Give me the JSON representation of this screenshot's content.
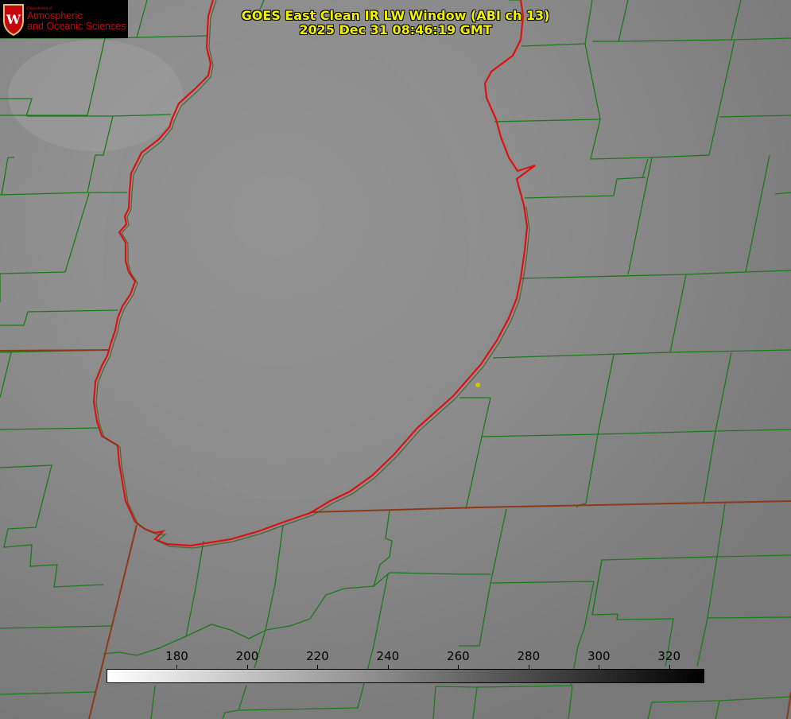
{
  "title": {
    "line1": "GOES East Clean IR LW Window (ABI ch 13)",
    "line2": "2025 Dec 31 08:46:19 GMT"
  },
  "logo": {
    "small_text": "Department of",
    "line1": "Atmospheric",
    "line2": "and Oceanic Sciences"
  },
  "colorbar": {
    "min": 160,
    "max": 330,
    "ticks": [
      "180",
      "200",
      "220",
      "240",
      "260",
      "280",
      "300",
      "320"
    ]
  },
  "colors": {
    "county_lines": "#1a7a1a",
    "lake_shore": "#e01010",
    "title": "#f2f200",
    "logo": "#c5050c",
    "marker": "#d4c400"
  }
}
